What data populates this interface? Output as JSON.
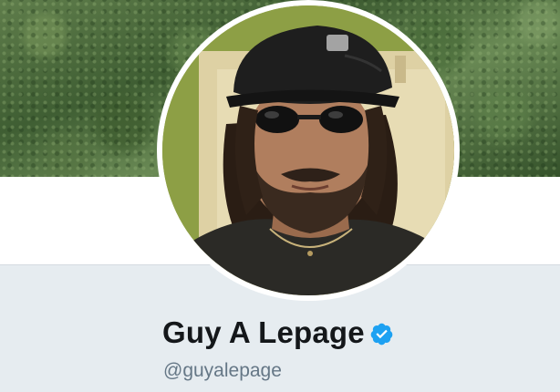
{
  "profile": {
    "display_name": "Guy A Lepage",
    "handle": "@guyalepage",
    "verified": true,
    "avatar_alt": "avatar"
  },
  "icons": {
    "verified": "verified-badge-icon"
  },
  "colors": {
    "page_background": "#e6ecf0",
    "card_background": "#ffffff",
    "name": "#14171a",
    "handle": "#657786",
    "verified_badge": "#1da1f2"
  }
}
